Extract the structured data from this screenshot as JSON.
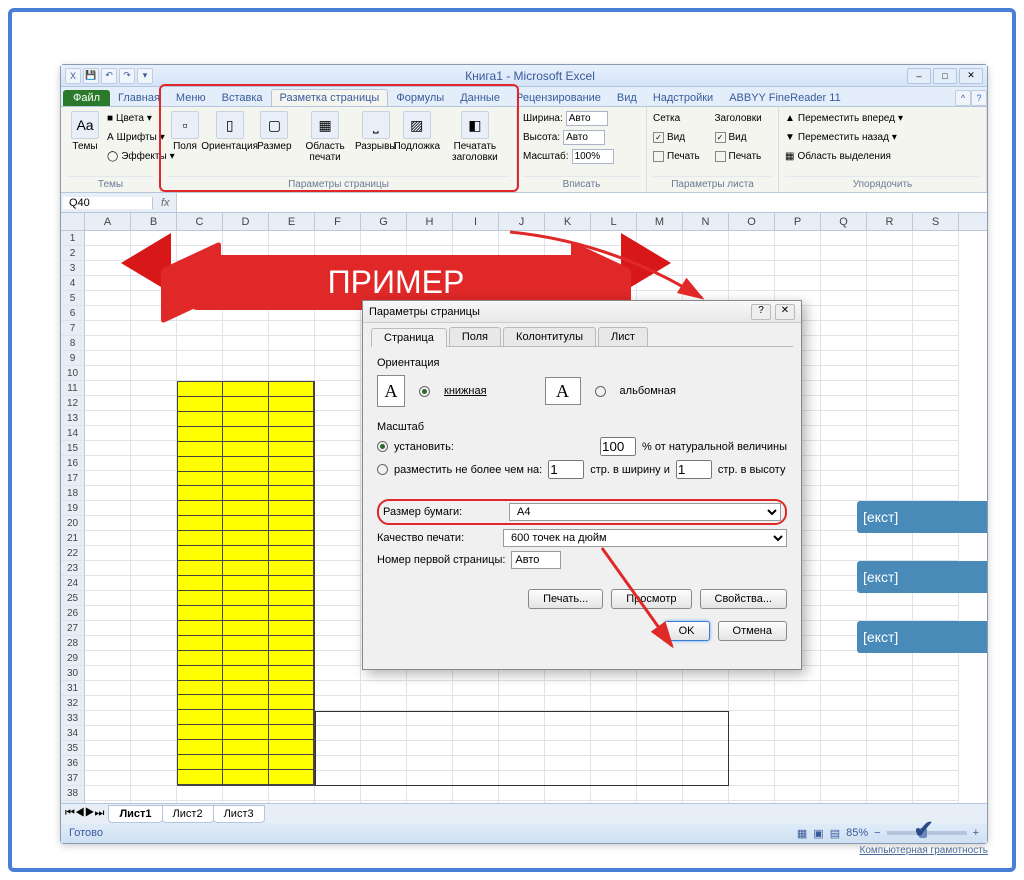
{
  "window": {
    "title": "Книга1 - Microsoft Excel"
  },
  "tabs": {
    "file": "Файл",
    "home": "Главная",
    "menu": "Меню",
    "insert": "Вставка",
    "pagelayout": "Разметка страницы",
    "formulas": "Формулы",
    "data": "Данные",
    "review": "Рецензирование",
    "view": "Вид",
    "addins": "Надстройки",
    "abbyy": "ABBYY FineReader 11"
  },
  "ribbon": {
    "themes": {
      "label": "Темы",
      "themes": "Темы",
      "colors": "Цвета",
      "fonts": "Шрифты",
      "effects": "Эффекты"
    },
    "pagesetup": {
      "label": "Параметры страницы",
      "margins": "Поля",
      "orientation": "Ориентация",
      "size": "Размер",
      "printarea": "Область печати",
      "breaks": "Разрывы",
      "background": "Подложка",
      "printtitles": "Печатать заголовки"
    },
    "scale": {
      "label": "Вписать",
      "width": "Ширина:",
      "height": "Высота:",
      "scale": "Масштаб:",
      "auto": "Авто",
      "pct": "100%"
    },
    "sheetopts": {
      "label": "Параметры листа",
      "gridlines": "Сетка",
      "headings": "Заголовки",
      "view": "Вид",
      "print": "Печать"
    },
    "arrange": {
      "label": "Упорядочить",
      "forward": "Переместить вперед",
      "backward": "Переместить назад",
      "selpane": "Область выделения"
    }
  },
  "namebox": "Q40",
  "banner_text": "ПРИМЕР",
  "blue_text": "[екст]",
  "sheets": {
    "s1": "Лист1",
    "s2": "Лист2",
    "s3": "Лист3"
  },
  "status": {
    "ready": "Готово",
    "zoom": "85%"
  },
  "cols": [
    "A",
    "B",
    "C",
    "D",
    "E",
    "F",
    "G",
    "H",
    "I",
    "J",
    "K",
    "L",
    "M",
    "N",
    "O",
    "P",
    "Q",
    "R",
    "S"
  ],
  "dialog": {
    "title": "Параметры страницы",
    "tabs": {
      "page": "Страница",
      "margins": "Поля",
      "headerfooter": "Колонтитулы",
      "sheet": "Лист"
    },
    "orientation": {
      "label": "Ориентация",
      "portrait": "книжная",
      "landscape": "альбомная"
    },
    "scaling": {
      "label": "Масштаб",
      "adjust": "установить:",
      "adjust_val": "100",
      "adjust_suffix": "% от натуральной величины",
      "fit": "разместить не более чем на:",
      "fit_w": "1",
      "fit_mid": "стр. в ширину и",
      "fit_h": "1",
      "fit_suffix": "стр. в высоту"
    },
    "papersize": {
      "label": "Размер бумаги:",
      "value": "A4"
    },
    "printq": {
      "label": "Качество печати:",
      "value": "600 точек на дюйм"
    },
    "firstpage": {
      "label": "Номер первой страницы:",
      "value": "Авто"
    },
    "btns": {
      "print": "Печать...",
      "preview": "Просмотр",
      "props": "Свойства...",
      "ok": "OK",
      "cancel": "Отмена"
    }
  },
  "watermark": {
    "brand": "Компьютерная грамотность"
  }
}
